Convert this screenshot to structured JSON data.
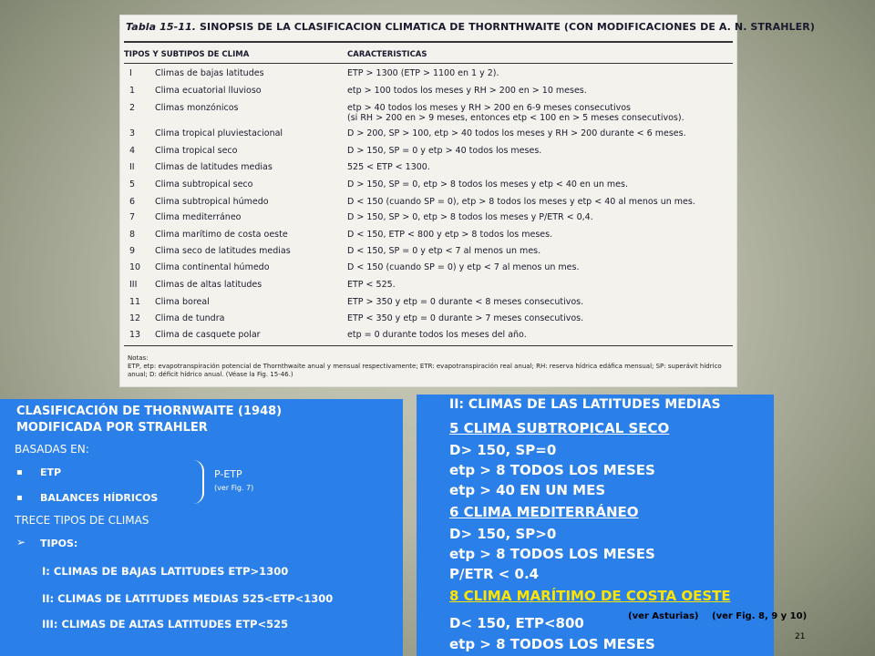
{
  "table": {
    "label": "Tabla 15-11.",
    "title": "SINOPSIS DE LA CLASIFICACION CLIMATICA DE THORNTHWAITE (CON MODIFICACIONES DE A. N. STRAHLER)",
    "col1_header": "TIPOS Y SUBTIPOS DE CLIMA",
    "col2_header": "CARACTERISTICAS",
    "rows": [
      {
        "num": "I",
        "name": "Climas de bajas latitudes",
        "char": "ETP > 1300 (ETP > 1100 en 1 y 2).",
        "char2": ""
      },
      {
        "num": "1",
        "name": "Clima ecuatorial lluvioso",
        "char": "etp > 100 todos los meses y RH > 200 en > 10 meses.",
        "char2": ""
      },
      {
        "num": "2",
        "name": "Climas monzónicos",
        "char": "etp > 40 todos los meses y RH > 200 en 6-9 meses consecutivos",
        "char2": "(si RH > 200 en > 9 meses, entonces etp < 100 en > 5 meses consecutivos)."
      },
      {
        "num": "3",
        "name": "Clima tropical pluviestacional",
        "char": "D > 200, SP > 100, etp > 40 todos los meses y RH > 200 durante < 6 meses.",
        "char2": ""
      },
      {
        "num": "4",
        "name": "Clima tropical seco",
        "char": "D > 150, SP = 0 y etp > 40 todos los meses.",
        "char2": ""
      },
      {
        "num": "II",
        "name": "Climas de latitudes medias",
        "char": "525 < ETP < 1300.",
        "char2": ""
      },
      {
        "num": "5",
        "name": "Clima subtropical seco",
        "char": "D > 150, SP = 0, etp > 8 todos los meses y etp < 40 en un mes.",
        "char2": ""
      },
      {
        "num": "6",
        "name": "Clima subtropical húmedo",
        "char": "D < 150 (cuando SP = 0), etp > 8 todos los meses y etp < 40 al menos un mes.",
        "char2": ""
      },
      {
        "num": "7",
        "name": "Clima mediterráneo",
        "char": "D > 150, SP > 0, etp > 8 todos los meses y P/ETR < 0,4.",
        "char2": ""
      },
      {
        "num": "8",
        "name": "Clima marítimo de costa oeste",
        "char": "D < 150, ETP < 800 y etp > 8 todos los meses.",
        "char2": ""
      },
      {
        "num": "9",
        "name": "Clima seco de latitudes medias",
        "char": "D < 150, SP = 0 y etp < 7 al menos un mes.",
        "char2": ""
      },
      {
        "num": "10",
        "name": "Clima continental húmedo",
        "char": "D < 150 (cuando SP = 0) y etp < 7 al menos un mes.",
        "char2": ""
      },
      {
        "num": "III",
        "name": "Climas de altas latitudes",
        "char": "ETP < 525.",
        "char2": ""
      },
      {
        "num": "11",
        "name": "Clima boreal",
        "char": "ETP > 350 y etp = 0 durante < 8 meses consecutivos.",
        "char2": ""
      },
      {
        "num": "12",
        "name": "Clima de tundra",
        "char": "ETP < 350 y etp = 0 durante > 7 meses consecutivos.",
        "char2": ""
      },
      {
        "num": "13",
        "name": "Clima de casquete polar",
        "char": "etp = 0 durante todos los meses del año.",
        "char2": ""
      }
    ],
    "notes_label": "Notas:",
    "notes": "ETP, etp: evapotranspiración potencial de Thornthwaite anual y mensual respectivamente; ETR: evapotranspiración real anual; RH: reserva hídrica edáfica mensual; SP: superávit hídrico anual; D: déficit hídrico anual. (Véase la Fig. 15-46.)"
  },
  "left": {
    "title_line1": "CLASIFICACIÓN DE THORNWAITE (1948)",
    "title_line2": "MODIFICADA POR STRAHLER",
    "based": "BASADAS EN:",
    "bullet1": "ETP",
    "bullet2": "BALANCES HÍDRICOS",
    "brace_label": "P-ETP",
    "brace_sub": "(ver Fig. 7)",
    "trece": "TRECE TIPOS DE CLIMAS",
    "tipos": "TIPOS:",
    "tipo1": "I: CLIMAS DE BAJAS LATITUDES ETP>1300",
    "tipo2": "II: CLIMAS DE LATITUDES MEDIAS 525<ETP<1300",
    "tipo3": "III: CLIMAS DE ALTAS LATITUDES ETP<525"
  },
  "right": {
    "heading": "II: CLIMAS DE LAS LATITUDES MEDIAS",
    "c5": "5 CLIMA SUBTROPICAL SECO",
    "c5a": "D> 150, SP=0",
    "c5b": "etp > 8 TODOS LOS MESES",
    "c5c": "etp > 40 EN UN MES",
    "c6": "6 CLIMA MEDITERRÁNEO",
    "c6a": "D> 150, SP>0",
    "c6b": "etp > 8 TODOS LOS MESES",
    "c6c": "P/ETR < 0.4",
    "c8": "8 CLIMA MARÍTIMO DE COSTA OESTE",
    "ref1": "(ver Asturias)",
    "ref2": "(ver Fig. 8, 9 y 10)",
    "c8a": "D< 150, ETP<800",
    "c8b": "etp > 8 TODOS LOS MESES",
    "page": "21"
  },
  "colors": {
    "panel": "#2a7fe8",
    "accent": "#ffe400"
  }
}
